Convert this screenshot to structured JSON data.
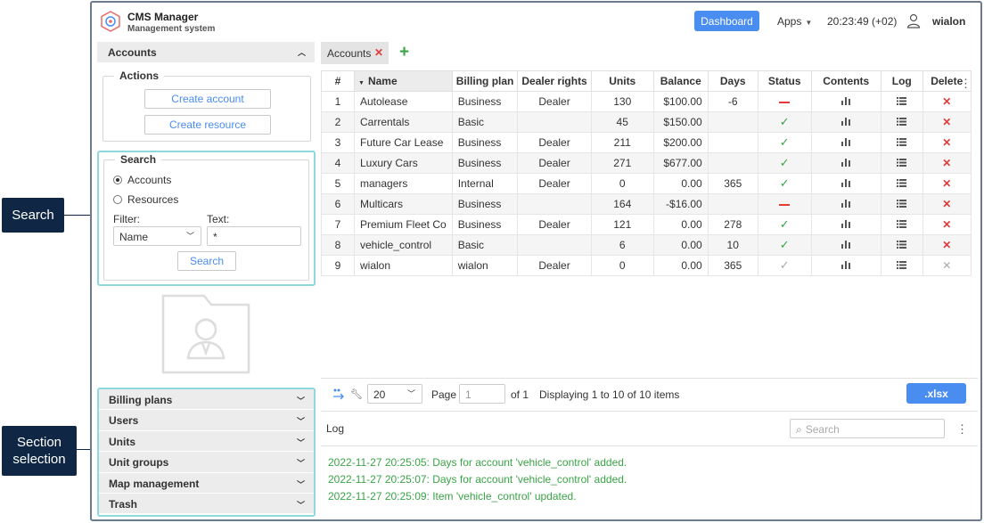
{
  "callouts": {
    "search": "Search",
    "section_selection": "Section selection"
  },
  "header": {
    "app_title": "CMS Manager",
    "app_subtitle": "Management system",
    "dashboard_label": "Dashboard",
    "apps_label": "Apps",
    "clock": "20:23:49 (+02)",
    "username": "wialon"
  },
  "left": {
    "accounts_header": "Accounts",
    "actions_legend": "Actions",
    "create_account": "Create account",
    "create_resource": "Create resource",
    "search_legend": "Search",
    "radio_accounts": "Accounts",
    "radio_resources": "Resources",
    "filter_label": "Filter:",
    "text_label": "Text:",
    "filter_value": "Name",
    "text_value": "*",
    "search_button": "Search",
    "sections": [
      "Billing plans",
      "Users",
      "Units",
      "Unit groups",
      "Map management",
      "Trash"
    ]
  },
  "tabs": {
    "active": "Accounts"
  },
  "table": {
    "headers": [
      "#",
      "Name",
      "Billing plan",
      "Dealer rights",
      "Units",
      "Balance",
      "Days",
      "Status",
      "Contents",
      "Log",
      "Delete"
    ],
    "rows": [
      {
        "num": "1",
        "name": "Autolease",
        "plan": "Business",
        "dealer": "Dealer",
        "units": "130",
        "balance": "$100.00",
        "days": "-6",
        "status": "blocked",
        "deletable": true
      },
      {
        "num": "2",
        "name": "Carrentals",
        "plan": "Basic",
        "dealer": "",
        "units": "45",
        "balance": "$150.00",
        "days": "",
        "status": "active",
        "deletable": true
      },
      {
        "num": "3",
        "name": "Future Car Lease",
        "plan": "Business",
        "dealer": "Dealer",
        "units": "211",
        "balance": "$200.00",
        "days": "",
        "status": "active",
        "deletable": true
      },
      {
        "num": "4",
        "name": "Luxury Cars",
        "plan": "Business",
        "dealer": "Dealer",
        "units": "271",
        "balance": "$677.00",
        "days": "",
        "status": "active",
        "deletable": true
      },
      {
        "num": "5",
        "name": "managers",
        "plan": "Internal",
        "dealer": "Dealer",
        "units": "0",
        "balance": "0.00",
        "days": "365",
        "status": "active",
        "deletable": true
      },
      {
        "num": "6",
        "name": "Multicars",
        "plan": "Business",
        "dealer": "",
        "units": "164",
        "balance": "-$16.00",
        "days": "",
        "status": "blocked",
        "deletable": true
      },
      {
        "num": "7",
        "name": "Premium Fleet Co",
        "plan": "Business",
        "dealer": "Dealer",
        "units": "121",
        "balance": "0.00",
        "days": "278",
        "status": "active",
        "deletable": true
      },
      {
        "num": "8",
        "name": "vehicle_control",
        "plan": "Basic",
        "dealer": "",
        "units": "6",
        "balance": "0.00",
        "days": "10",
        "status": "active",
        "deletable": true
      },
      {
        "num": "9",
        "name": "wialon",
        "plan": "wialon",
        "dealer": "Dealer",
        "units": "0",
        "balance": "0.00",
        "days": "365",
        "status": "inactive",
        "deletable": false
      }
    ]
  },
  "pager": {
    "page_size": "20",
    "page_label": "Page",
    "page_value": "1",
    "of_label": "of 1",
    "displaying": "Displaying 1 to 10 of 10 items",
    "export_label": ".xlsx"
  },
  "log": {
    "title": "Log",
    "search_placeholder": "Search",
    "entries": [
      "2022-11-27 20:25:05: Days for account 'vehicle_control' added.",
      "2022-11-27 20:25:07: Days for account 'vehicle_control' added.",
      "2022-11-27 20:25:09: Item 'vehicle_control' updated."
    ]
  },
  "colors": {
    "accent": "#4a8df0",
    "ok": "#3aa447",
    "danger": "#e03b3b",
    "highlight": "#8fd8e0",
    "callout": "#0f2744"
  }
}
